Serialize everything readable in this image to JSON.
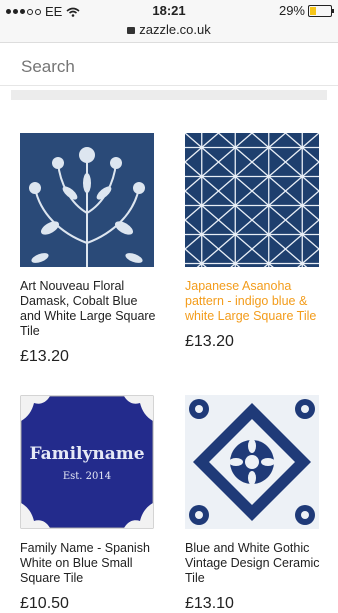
{
  "status": {
    "carrier": "EE",
    "time": "18:21",
    "battery": "29%",
    "battery_level": 0.29
  },
  "url": "zazzle.co.uk",
  "search": {
    "placeholder": "Search"
  },
  "products": [
    {
      "title": "Art Nouveau Floral Damask, Cobalt Blue and White Large Square Tile",
      "price": "£13.20",
      "highlight": false
    },
    {
      "title": "Japanese Asanoha pattern - indigo blue & white Large Square Tile",
      "price": "£13.20",
      "highlight": true
    },
    {
      "title": "Family Name - Spanish White on Blue Small Square Tile",
      "price": "£10.50",
      "highlight": false,
      "tile_name": "Familyname",
      "tile_sub": "Est. 2014"
    },
    {
      "title": "Blue and White Gothic Vintage Design Ceramic Tile",
      "price": "£13.10",
      "highlight": false
    }
  ],
  "colors": {
    "accent": "#f39c1b",
    "navy": "#1e3f6e",
    "cobalt": "#232b8c"
  }
}
